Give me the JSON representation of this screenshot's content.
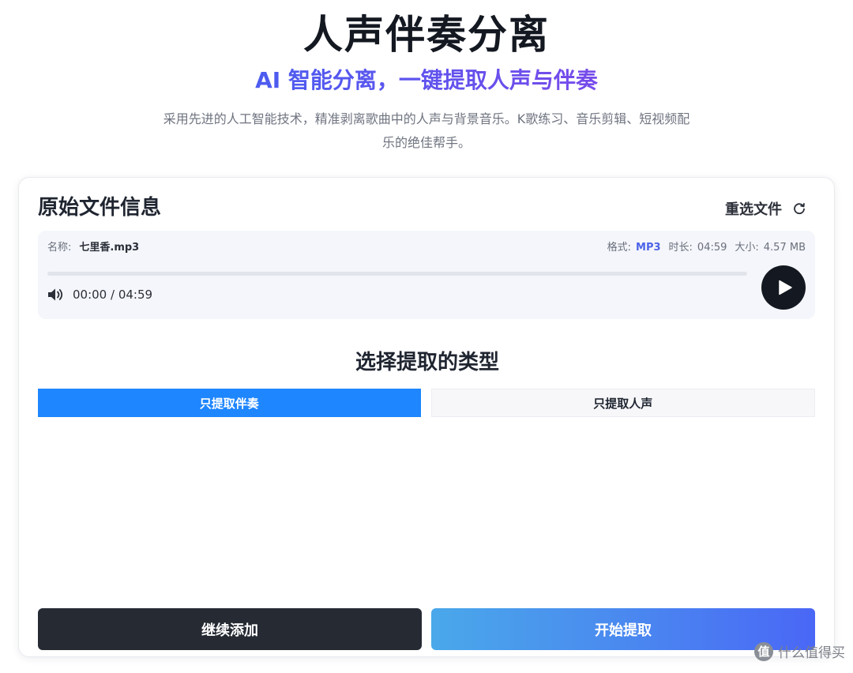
{
  "hero": {
    "title": "人声伴奏分离",
    "subtitle": "AI 智能分离，一键提取人声与伴奏",
    "description": "采用先进的人工智能技术，精准剥离歌曲中的人声与背景音乐。K歌练习、音乐剪辑、短视频配乐的绝佳帮手。"
  },
  "file_info": {
    "title": "原始文件信息",
    "reselect_label": "重选文件",
    "name_label": "名称:",
    "name_value": "七里香.mp3",
    "format_label": "格式:",
    "format_value": "MP3",
    "duration_label": "时长:",
    "duration_value": "04:59",
    "size_label": "大小:",
    "size_value": "4.57 MB",
    "time_readout": "00:00 / 04:59",
    "progress": 0
  },
  "extract": {
    "title": "选择提取的类型",
    "tabs": [
      {
        "label": "只提取伴奏",
        "active": true
      },
      {
        "label": "只提取人声",
        "active": false
      }
    ]
  },
  "actions": {
    "continue_label": "继续添加",
    "start_label": "开始提取"
  },
  "watermark": {
    "badge": "值",
    "text": "什么值得买"
  },
  "colors": {
    "accent_blue": "#1e86ff",
    "format_highlight": "#4c63e8",
    "dark_button": "#252a33"
  }
}
